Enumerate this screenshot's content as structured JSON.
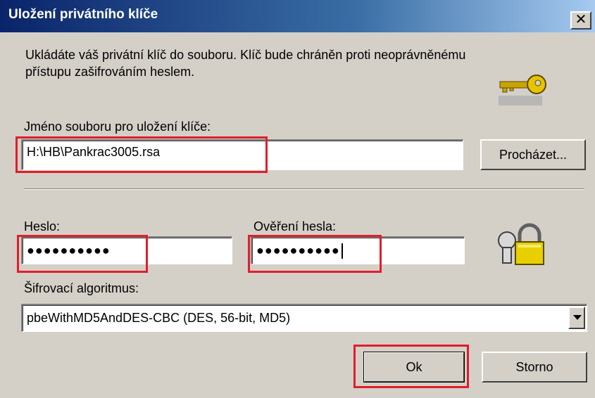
{
  "window": {
    "title": "Uložení privátního klíče",
    "close_glyph": "✕"
  },
  "description": "Ukládáte váš privátní klíč do souboru. Klíč bude chráněn proti neoprávněnému přístupu zašifrováním heslem.",
  "file": {
    "label": "Jméno souboru pro uložení klíče:",
    "value": "H:\\HB\\Pankrac3005.rsa",
    "browse_label": "Procházet..."
  },
  "password": {
    "label": "Heslo:",
    "masked": "●●●●●●●●●●"
  },
  "password_confirm": {
    "label": "Ověření hesla:",
    "masked": "●●●●●●●●●●"
  },
  "algorithm": {
    "label": "Šifrovací algoritmus:",
    "selected": "pbeWithMD5AndDES-CBC (DES, 56-bit, MD5)"
  },
  "buttons": {
    "ok": "Ok",
    "cancel": "Storno"
  },
  "icons": {
    "key": "key-icon",
    "lock": "padlock-keys-icon"
  },
  "colors": {
    "highlight": "#e01e2b",
    "titlebar": "#0a246a"
  }
}
